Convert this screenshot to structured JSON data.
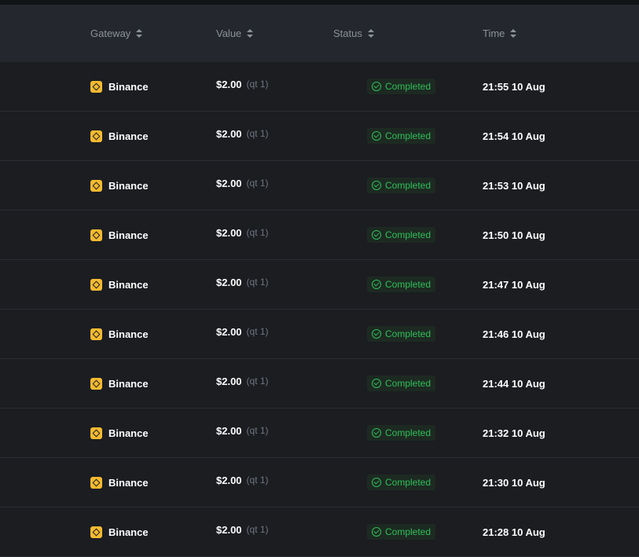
{
  "headers": {
    "gateway": "Gateway",
    "value": "Value",
    "status": "Status",
    "time": "Time"
  },
  "gateway_color": "#f3ba2f",
  "status_color": "#2fbf59",
  "rows": [
    {
      "gateway": "Binance",
      "price": "$2.00",
      "qty": "(qt 1)",
      "status": "Completed",
      "time": "21:55 10 Aug"
    },
    {
      "gateway": "Binance",
      "price": "$2.00",
      "qty": "(qt 1)",
      "status": "Completed",
      "time": "21:54 10 Aug"
    },
    {
      "gateway": "Binance",
      "price": "$2.00",
      "qty": "(qt 1)",
      "status": "Completed",
      "time": "21:53 10 Aug"
    },
    {
      "gateway": "Binance",
      "price": "$2.00",
      "qty": "(qt 1)",
      "status": "Completed",
      "time": "21:50 10 Aug"
    },
    {
      "gateway": "Binance",
      "price": "$2.00",
      "qty": "(qt 1)",
      "status": "Completed",
      "time": "21:47 10 Aug"
    },
    {
      "gateway": "Binance",
      "price": "$2.00",
      "qty": "(qt 1)",
      "status": "Completed",
      "time": "21:46 10 Aug"
    },
    {
      "gateway": "Binance",
      "price": "$2.00",
      "qty": "(qt 1)",
      "status": "Completed",
      "time": "21:44 10 Aug"
    },
    {
      "gateway": "Binance",
      "price": "$2.00",
      "qty": "(qt 1)",
      "status": "Completed",
      "time": "21:32 10 Aug"
    },
    {
      "gateway": "Binance",
      "price": "$2.00",
      "qty": "(qt 1)",
      "status": "Completed",
      "time": "21:30 10 Aug"
    },
    {
      "gateway": "Binance",
      "price": "$2.00",
      "qty": "(qt 1)",
      "status": "Completed",
      "time": "21:28 10 Aug"
    }
  ]
}
